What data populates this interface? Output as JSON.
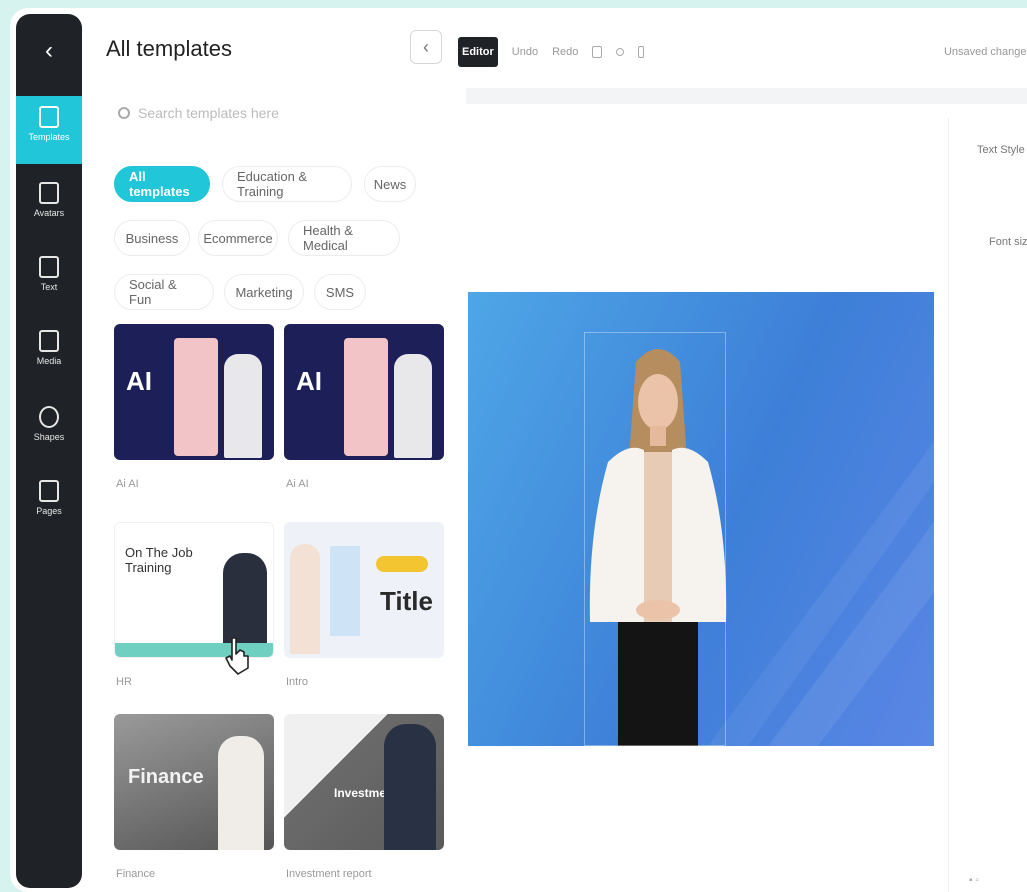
{
  "panel": {
    "title": "All templates",
    "search_placeholder": "Search templates here",
    "collapse_icon": "chevron-left-icon"
  },
  "rail": {
    "items": [
      {
        "label": "Templates",
        "icon": "grid-icon"
      },
      {
        "label": "Avatars",
        "icon": "avatar-icon"
      },
      {
        "label": "Text",
        "icon": "text-icon"
      },
      {
        "label": "Media",
        "icon": "media-icon"
      },
      {
        "label": "Shapes",
        "icon": "shape-icon"
      },
      {
        "label": "Pages",
        "icon": "pages-icon"
      }
    ]
  },
  "chips": [
    {
      "label": "All templates",
      "active": true
    },
    {
      "label": "Education & Training"
    },
    {
      "label": "News"
    },
    {
      "label": "Business"
    },
    {
      "label": "Ecommerce"
    },
    {
      "label": "Health & Medical"
    },
    {
      "label": "Social & Fun"
    },
    {
      "label": "Marketing"
    },
    {
      "label": "SMS"
    }
  ],
  "templates": [
    {
      "label": "Aa AI",
      "word": "AI",
      "label_text": "Ai AI"
    },
    {
      "label": "Aa AI",
      "word": "AI",
      "label_text": "Ai AI"
    },
    {
      "label": "HR",
      "heading": "On The Job Training",
      "label_text": "HR"
    },
    {
      "label": "Intro",
      "word": "Title",
      "label_text": "Intro"
    },
    {
      "label": "Finance",
      "word": "Finance",
      "label_text": "Finance"
    },
    {
      "label": "Investment report",
      "word": "Investment report",
      "label_text": "Investment report"
    }
  ],
  "toolbar": {
    "mode": "Editor",
    "undo": "Undo",
    "redo": "Redo",
    "preview": "Preview video",
    "right_action": "Unsaved changes"
  },
  "right_panel": {
    "row1": "Text Style",
    "row2": "Font size"
  }
}
